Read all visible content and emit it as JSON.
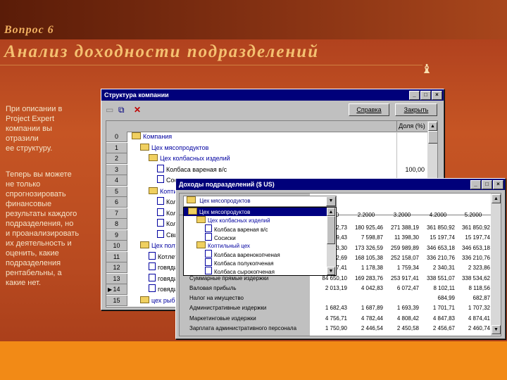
{
  "slide": {
    "header": "Вопрос 6",
    "title": "Анализ доходности подразделений",
    "text1": [
      "При описании в",
      "Project Expert",
      "компании вы",
      "отразили",
      "ее структуру."
    ],
    "text2": [
      "Теперь вы можете",
      "не только",
      "спрогнозировать",
      "финансовые",
      "результаты каждого",
      "подразделения, но",
      "и проанализировать",
      "их деятельность и",
      "оценить, какие",
      "подразделения",
      "рентабельны, а",
      "какие нет."
    ]
  },
  "structure_window": {
    "title": "Структура компании",
    "help_button": "Справка",
    "close_button": "Закрыть",
    "column_header": "Доля (%)",
    "rows": [
      {
        "num": "0",
        "label": "Компания",
        "type": "folder",
        "level": 0,
        "value": ""
      },
      {
        "num": "1",
        "label": "Цех мясопродуктов",
        "type": "folder",
        "level": 1,
        "value": ""
      },
      {
        "num": "2",
        "label": "Цех колбасных изделий",
        "type": "folder",
        "level": 2,
        "value": ""
      },
      {
        "num": "3",
        "label": "Колбаса вареная в/с",
        "type": "doc",
        "level": 3,
        "value": "100,00"
      },
      {
        "num": "4",
        "label": "Сосиски",
        "type": "doc",
        "level": 3,
        "value": ""
      },
      {
        "num": "5",
        "label": "Коптильный цех",
        "type": "folder",
        "level": 2,
        "value": ""
      },
      {
        "num": "6",
        "label": "Колбаса варенокопченая",
        "type": "doc",
        "level": 3,
        "value": ""
      },
      {
        "num": "7",
        "label": "Колбаса полукопченая",
        "type": "doc",
        "level": 3,
        "value": ""
      },
      {
        "num": "8",
        "label": "Колбаса сырокопченая",
        "type": "doc",
        "level": 3,
        "value": ""
      },
      {
        "num": "9",
        "label": "Свинина копченая",
        "type": "doc",
        "level": 3,
        "value": ""
      },
      {
        "num": "10",
        "label": "Цех полуфабрикатов",
        "type": "folder",
        "level": 1,
        "value": ""
      },
      {
        "num": "11",
        "label": "Котлеты",
        "type": "doc",
        "level": 2,
        "value": ""
      },
      {
        "num": "12",
        "label": "говядина",
        "type": "doc",
        "level": 2,
        "value": ""
      },
      {
        "num": "13",
        "label": "говядина",
        "type": "doc",
        "level": 2,
        "value": ""
      },
      {
        "num": "14",
        "label": "говядина",
        "type": "doc",
        "level": 2,
        "value": ""
      },
      {
        "num": "15",
        "label": "цех рыбопродуктов",
        "type": "folder",
        "level": 1,
        "value": ""
      }
    ]
  },
  "income_window": {
    "title": "Доходы подразделений ($ US)",
    "combo_value": "Цех мясопродуктов",
    "dropdown_items": [
      {
        "label": "Цех мясопродуктов",
        "type": "folder",
        "level": 0,
        "selected": true
      },
      {
        "label": "Цех колбасных изделий",
        "type": "folder",
        "level": 1,
        "selected": false
      },
      {
        "label": "Колбаса вареная в/с",
        "type": "doc",
        "level": 2,
        "selected": false
      },
      {
        "label": "Сосиски",
        "type": "doc",
        "level": 2,
        "selected": false
      },
      {
        "label": "Коптильный цех",
        "type": "folder",
        "level": 1,
        "selected": false
      },
      {
        "label": "Колбаса варенокопченая",
        "type": "doc",
        "level": 2,
        "selected": false
      },
      {
        "label": "Колбаса полукопченая",
        "type": "doc",
        "level": 2,
        "selected": false
      },
      {
        "label": "Колбаса сырокопченая",
        "type": "doc",
        "level": 2,
        "selected": false
      }
    ],
    "columns": [
      "1.2000",
      "2.2000",
      "3.2000",
      "4.2000",
      "5.2000"
    ],
    "rows": [
      {
        "label": "",
        "values": [
          "90 462,73",
          "180 925,46",
          "271 388,19",
          "361 850,92",
          "361 850,92"
        ]
      },
      {
        "label": "",
        "values": [
          "3 799,43",
          "7 598,87",
          "11 398,30",
          "15 197,74",
          "15 197,74"
        ]
      },
      {
        "label": "",
        "values": [
          "86 663,30",
          "173 326,59",
          "259 989,89",
          "346 653,18",
          "346 653,18"
        ]
      },
      {
        "label": "",
        "values": [
          "84 052,69",
          "168 105,38",
          "252 158,07",
          "336 210,76",
          "336 210,76"
        ]
      },
      {
        "label": "",
        "values": [
          "597,41",
          "1 178,38",
          "1 759,34",
          "2 340,31",
          "2 323,86"
        ]
      },
      {
        "label": "Суммарные прямые издержки",
        "values": [
          "84 650,10",
          "169 283,76",
          "253 917,41",
          "338 551,07",
          "338 534,62"
        ]
      },
      {
        "label": "Валовая прибыль",
        "values": [
          "2 013,19",
          "4 042,83",
          "6 072,47",
          "8 102,11",
          "8 118,56"
        ]
      },
      {
        "label": "Налог на имущество",
        "values": [
          "",
          "",
          "",
          "684,99",
          "682,87"
        ]
      },
      {
        "label": "Административные издержки",
        "values": [
          "1 682,43",
          "1 687,89",
          "1 693,39",
          "1 701,71",
          "1 707,32"
        ]
      },
      {
        "label": "Маркетинговые издержки",
        "values": [
          "4 756,71",
          "4 782,44",
          "4 808,42",
          "4 847,83",
          "4 874,41"
        ]
      },
      {
        "label": "Зарплата административного персонала",
        "values": [
          "1 750,90",
          "2 446,54",
          "2 450,58",
          "2 456,67",
          "2 460,74"
        ]
      }
    ]
  }
}
